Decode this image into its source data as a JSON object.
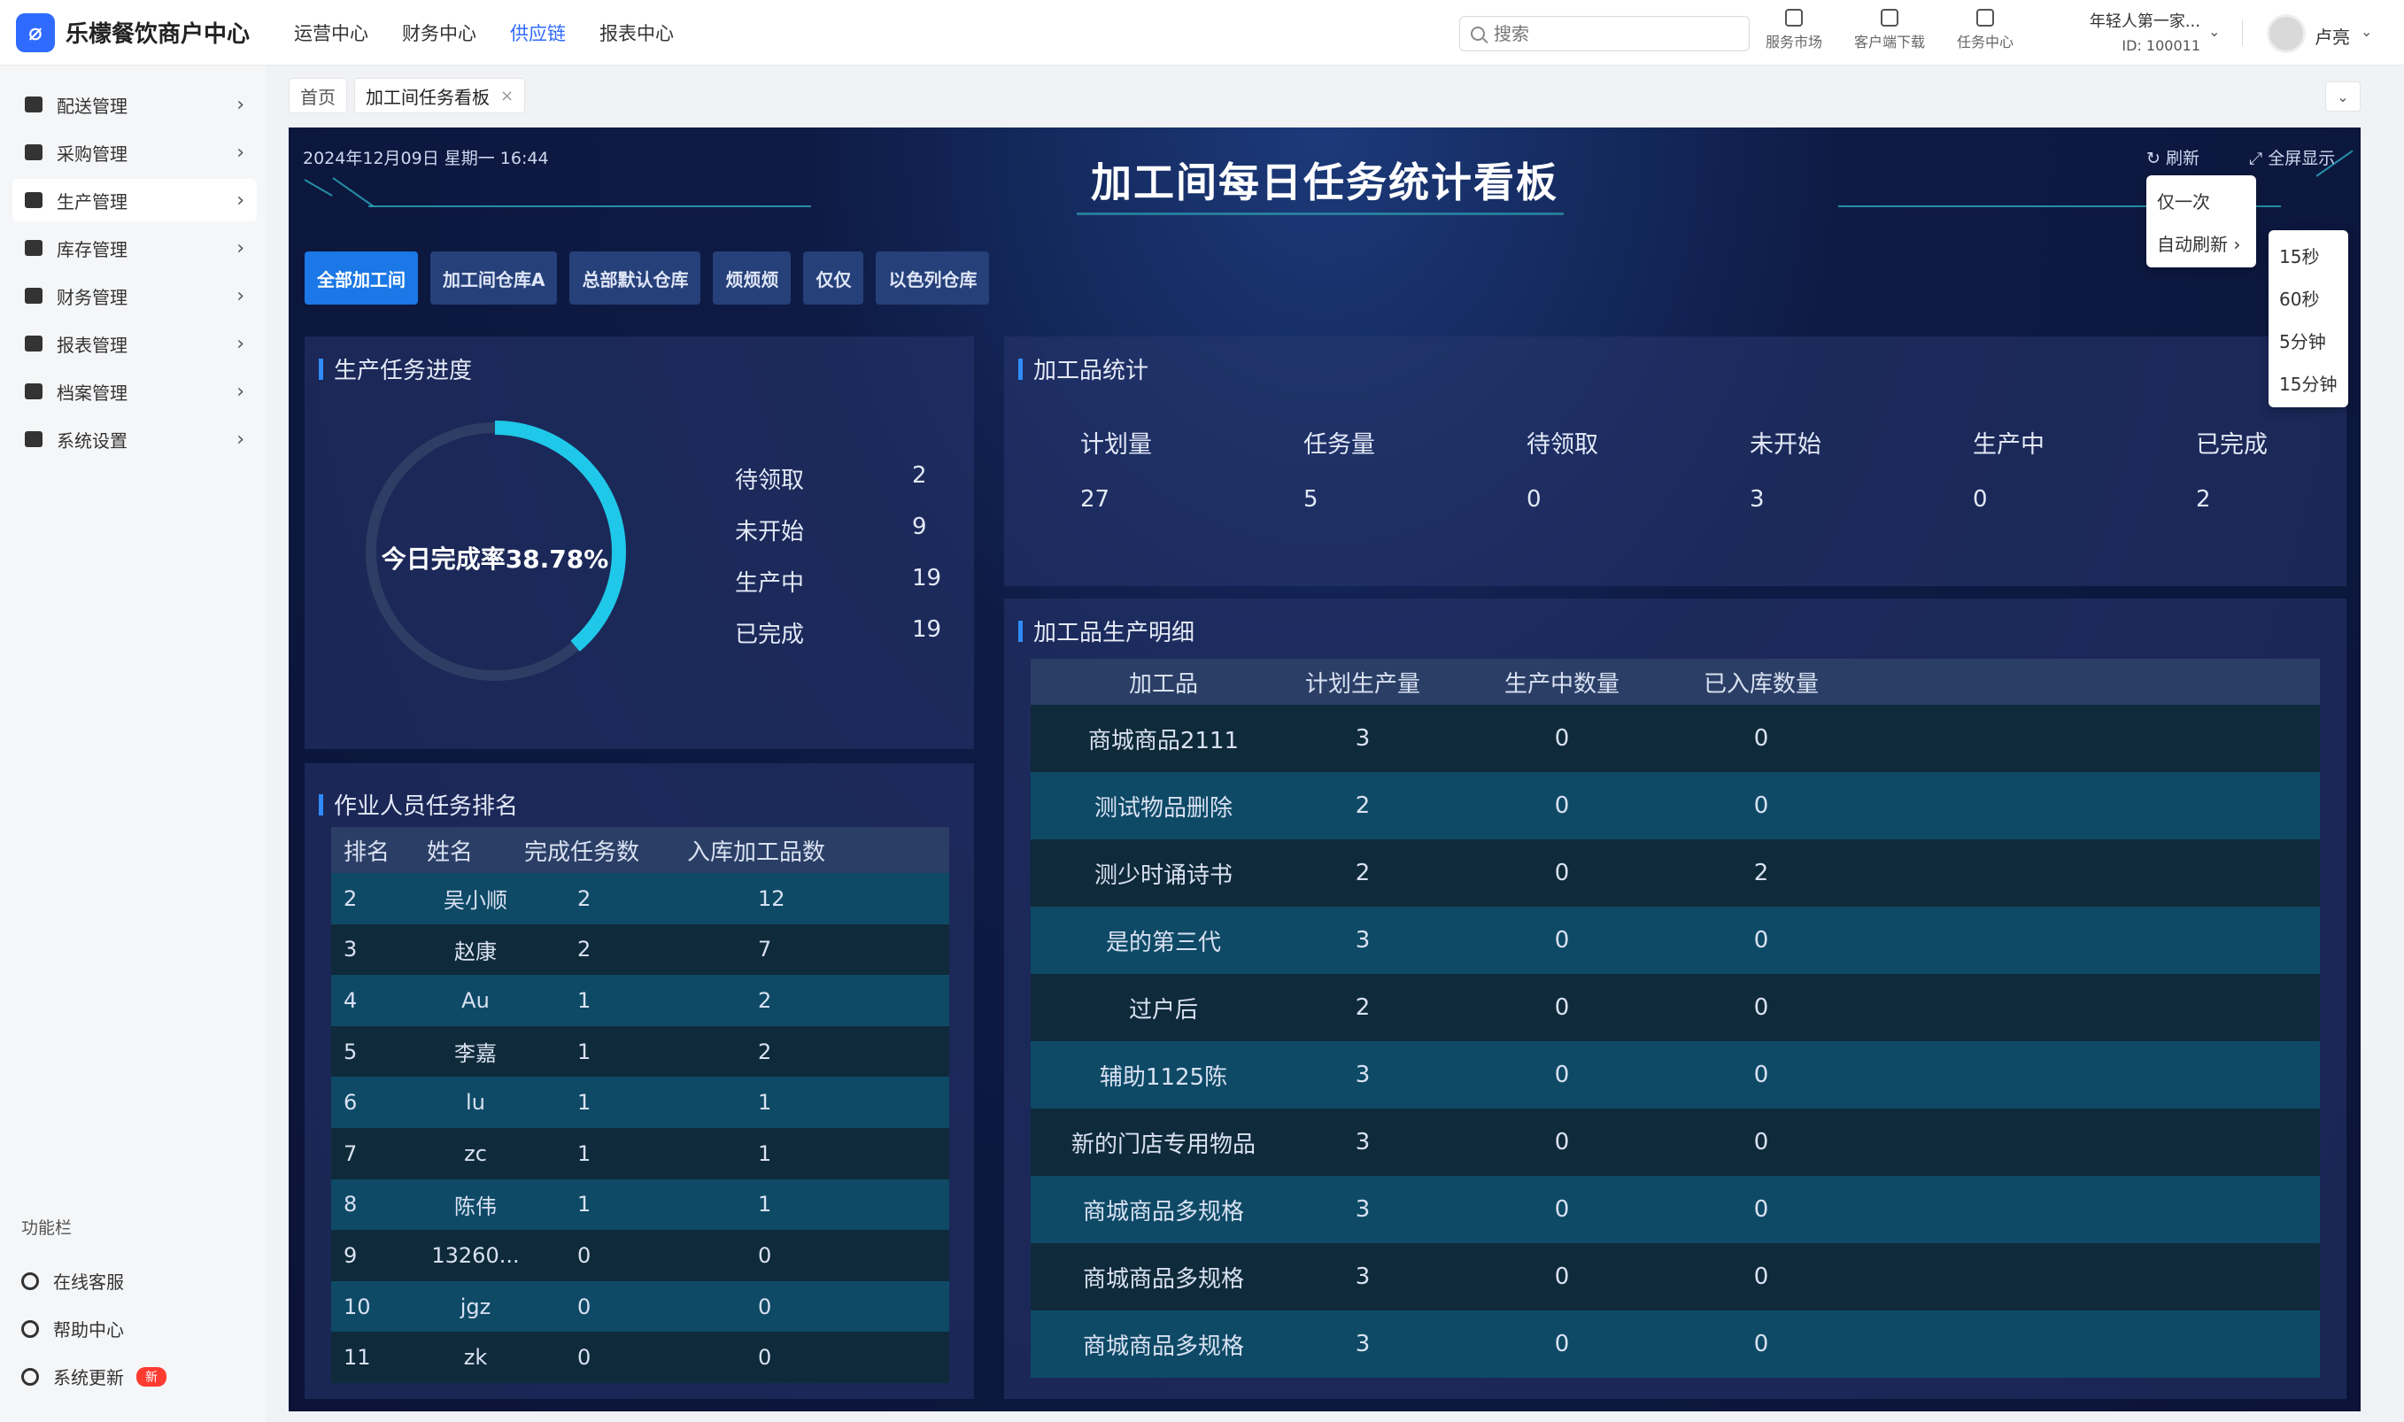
{
  "app": {
    "title": "乐檬餐饮商户中心",
    "logo_glyph": "⌀"
  },
  "topnav": [
    {
      "label": "运营中心",
      "active": false
    },
    {
      "label": "财务中心",
      "active": false
    },
    {
      "label": "供应链",
      "active": true
    },
    {
      "label": "报表中心",
      "active": false
    }
  ],
  "search": {
    "placeholder": "搜索"
  },
  "tools": {
    "market": "服务市场",
    "download": "客户端下载",
    "tasks": "任务中心"
  },
  "tenant": {
    "name": "年轻人第一家...",
    "id": "ID: 100011"
  },
  "user": {
    "name": "卢亮"
  },
  "sidebar": {
    "items": [
      {
        "label": "配送管理"
      },
      {
        "label": "采购管理"
      },
      {
        "label": "生产管理"
      },
      {
        "label": "库存管理"
      },
      {
        "label": "财务管理"
      },
      {
        "label": "报表管理"
      },
      {
        "label": "档案管理"
      },
      {
        "label": "系统设置"
      }
    ],
    "section": "功能栏",
    "footer": [
      {
        "label": "在线客服"
      },
      {
        "label": "帮助中心"
      },
      {
        "label": "系统更新",
        "badge": "新"
      }
    ]
  },
  "tabs": [
    {
      "label": "首页"
    },
    {
      "label": "加工间任务看板",
      "close": "×"
    }
  ],
  "board": {
    "datetime": "2024年12月09日 星期一 16:44",
    "title": "加工间每日任务统计看板",
    "refresh": "刷新",
    "fullscreen": "全屏显示",
    "workshops": [
      "全部加工间",
      "加工间仓库A",
      "总部默认仓库",
      "烦烦烦",
      "仅仅",
      "以色列仓库"
    ],
    "progress": {
      "title": "生产任务进度",
      "rate_text": "今日完成率38.78%",
      "rate": 38.78,
      "stats": [
        {
          "label": "待领取",
          "value": "2"
        },
        {
          "label": "未开始",
          "value": "9"
        },
        {
          "label": "生产中",
          "value": "19"
        },
        {
          "label": "已完成",
          "value": "19"
        }
      ],
      "colors": {
        "ring_fill": "#1fc8e8",
        "ring_track": "#2e3d63"
      }
    },
    "goods_stats": {
      "title": "加工品统计",
      "cols": [
        {
          "label": "计划量",
          "value": "27"
        },
        {
          "label": "任务量",
          "value": "5"
        },
        {
          "label": "待领取",
          "value": "0"
        },
        {
          "label": "未开始",
          "value": "3"
        },
        {
          "label": "生产中",
          "value": "0"
        },
        {
          "label": "已完成",
          "value": "2"
        }
      ]
    },
    "ranking": {
      "title": "作业人员任务排名",
      "headers": [
        "排名",
        "姓名",
        "完成任务数",
        "入库加工品数"
      ],
      "rows": [
        [
          "2",
          "吴小顺",
          "2",
          "12"
        ],
        [
          "3",
          "赵康",
          "2",
          "7"
        ],
        [
          "4",
          "Au",
          "1",
          "2"
        ],
        [
          "5",
          "李嘉",
          "1",
          "2"
        ],
        [
          "6",
          "lu",
          "1",
          "1"
        ],
        [
          "7",
          "zc",
          "1",
          "1"
        ],
        [
          "8",
          "陈伟",
          "1",
          "1"
        ],
        [
          "9",
          "13260...",
          "0",
          "0"
        ],
        [
          "10",
          "jgz",
          "0",
          "0"
        ],
        [
          "11",
          "zk",
          "0",
          "0"
        ]
      ]
    },
    "detail": {
      "title": "加工品生产明细",
      "headers": [
        "加工品",
        "计划生产量",
        "生产中数量",
        "已入库数量"
      ],
      "rows": [
        [
          "商城商品2111",
          "3",
          "0",
          "0"
        ],
        [
          "测试物品删除",
          "2",
          "0",
          "0"
        ],
        [
          "测少时诵诗书",
          "2",
          "0",
          "2"
        ],
        [
          "是的第三代",
          "3",
          "0",
          "0"
        ],
        [
          "过户后",
          "2",
          "0",
          "0"
        ],
        [
          "辅助1125陈",
          "3",
          "0",
          "0"
        ],
        [
          "新的门店专用物品",
          "3",
          "0",
          "0"
        ],
        [
          "商城商品多规格",
          "3",
          "0",
          "0"
        ],
        [
          "商城商品多规格",
          "3",
          "0",
          "0"
        ],
        [
          "商城商品多规格",
          "3",
          "0",
          "0"
        ]
      ]
    },
    "refresh_menu": {
      "items": [
        "仅一次",
        "自动刷新"
      ],
      "submenu": [
        "15秒",
        "60秒",
        "5分钟",
        "15分钟"
      ]
    }
  }
}
